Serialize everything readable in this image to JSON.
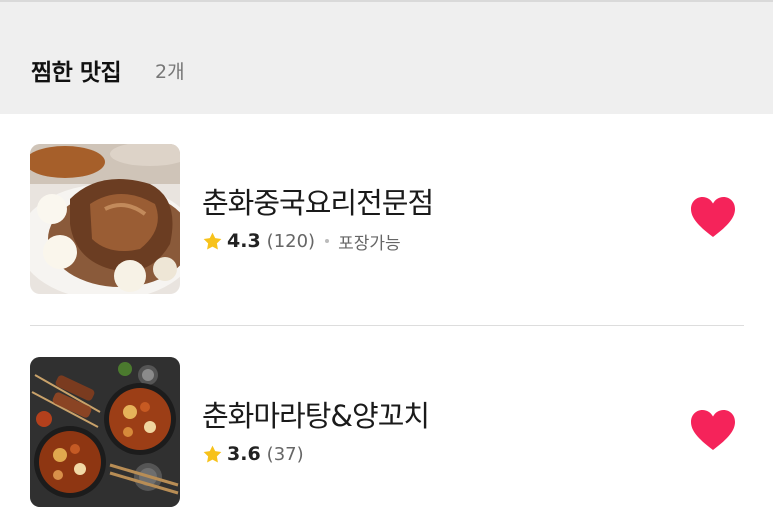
{
  "header": {
    "title": "찜한 맛집",
    "count": "2개"
  },
  "restaurants": [
    {
      "name": "춘화중국요리전문점",
      "rating": "4.3",
      "reviews": "(120)",
      "tag": "포장가능",
      "image_icon": "braised-meat-dish-photo"
    },
    {
      "name": "춘화마라탕&양꼬치",
      "rating": "3.6",
      "reviews": "(37)",
      "image_icon": "malatang-skewers-dish-photo"
    }
  ],
  "colors": {
    "heart": "#f5235a",
    "star": "#f7c21b",
    "header_bg": "#efefef"
  }
}
